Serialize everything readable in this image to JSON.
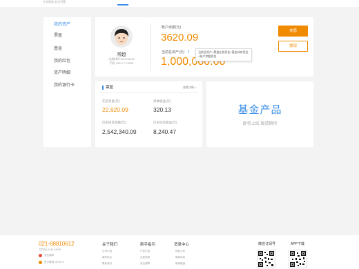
{
  "header": {
    "logo_sub": "专业高效 安全可靠",
    "accent": "#3a8ee6"
  },
  "sidebar": {
    "items": [
      {
        "label": "我的资产",
        "active": true
      },
      {
        "label": "票盈",
        "active": false
      },
      {
        "label": "基金",
        "active": false
      },
      {
        "label": "我的红包",
        "active": false
      },
      {
        "label": "资产明细",
        "active": false
      },
      {
        "label": "我的银行卡",
        "active": false
      }
    ],
    "active_color": "#3a8ee6",
    "normal_color": "#555555"
  },
  "profile": {
    "username": "常超",
    "register_time": "注册时间 2016-08-02",
    "phone": "手机 1321*****3226",
    "balance_label": "账户余额(元)",
    "balance": "3620.09",
    "total_assets_label": "当前总资产(元)",
    "total_assets": "1,000,000.00",
    "tooltip": "当前总资产=票盈在投资金+基金持有资金+账户余额资金",
    "recharge_label": "充值",
    "withdraw_label": "提现",
    "accent": "#f08a00"
  },
  "fund": {
    "title": "票盈",
    "more": "查看详情 >",
    "cells": [
      {
        "label": "在投资金(元)",
        "value": "22,620.09",
        "highlight": true
      },
      {
        "label": "待收收益(元)",
        "value": "320.13",
        "highlight": false
      },
      {
        "label": "历史投资总额(元)",
        "value": "2,542,340.09",
        "highlight": false
      },
      {
        "label": "历史投资收益(元)",
        "value": "8,240.47",
        "highlight": false
      }
    ]
  },
  "product": {
    "title": "基金产品",
    "subtitle": "即将上线,敬请期待"
  },
  "footer": {
    "hotline": "021-68810612",
    "hours": "工作日 9:00-18:00",
    "misc": [
      {
        "text": "安全保障",
        "color": "#e74c3c"
      },
      {
        "text": "官方微博: @XXXX",
        "color": "#f08a00"
      }
    ],
    "columns": [
      {
        "title": "关于我们",
        "links": [
          "公司介绍",
          "服务协议",
          "联系我们"
        ]
      },
      {
        "title": "新手指引",
        "links": [
          "产品介绍",
          "注册流程",
          "安全保障"
        ]
      },
      {
        "title": "消息中心",
        "links": [
          "网站公告",
          "新闻动态",
          "媒体报道"
        ]
      }
    ],
    "qr": [
      {
        "title": "微信订阅号"
      },
      {
        "title": "APP下载"
      }
    ]
  }
}
